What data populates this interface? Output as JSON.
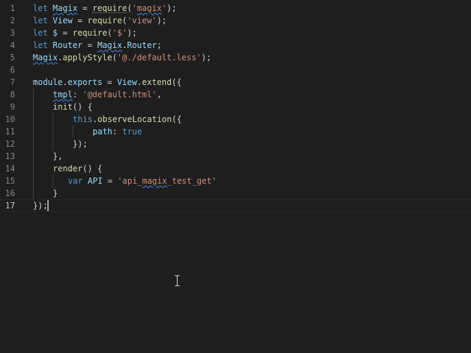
{
  "editor": {
    "line_numbers": [
      "1",
      "2",
      "3",
      "4",
      "5",
      "6",
      "7",
      "8",
      "9",
      "10",
      "11",
      "12",
      "13",
      "14",
      "15",
      "16",
      "17"
    ],
    "lines": {
      "l1": {
        "t1": "let",
        "t2": " ",
        "t3": "Magix",
        "t4": " = ",
        "t5": "require",
        "t6": "(",
        "t7": "'",
        "t8": "magix",
        "t9": "'",
        "t10": ");"
      },
      "l2": {
        "t1": "let",
        "t2": " ",
        "t3": "View",
        "t4": " = ",
        "t5": "require",
        "t6": "(",
        "t7": "'view'",
        "t8": ");"
      },
      "l3": {
        "t1": "let",
        "t2": " ",
        "t3": "$",
        "t4": " = ",
        "t5": "require",
        "t6": "(",
        "t7": "'$'",
        "t8": ");"
      },
      "l4": {
        "t1": "let",
        "t2": " ",
        "t3": "Router",
        "t4": " = ",
        "t5": "Magix",
        "t6": ".",
        "t7": "Router",
        "t8": ";"
      },
      "l5": {
        "t1": "Magix",
        "t2": ".",
        "t3": "applyStyle",
        "t4": "(",
        "t5": "'@./default.less'",
        "t6": ");"
      },
      "l7": {
        "t1": "module",
        "t2": ".",
        "t3": "exports",
        "t4": " = ",
        "t5": "View",
        "t6": ".",
        "t7": "extend",
        "t8": "({"
      },
      "l8": {
        "t1": "tmpl",
        "t2": ": ",
        "t3": "'@default.html'",
        "t4": ","
      },
      "l9": {
        "t1": "init",
        "t2": "() {"
      },
      "l10": {
        "t1": "this",
        "t2": ".",
        "t3": "observeLocation",
        "t4": "({"
      },
      "l11": {
        "t1": "path",
        "t2": ": ",
        "t3": "true"
      },
      "l12": {
        "t1": "});"
      },
      "l13": {
        "t1": "},"
      },
      "l14": {
        "t1": "render",
        "t2": "() {"
      },
      "l15": {
        "t1": "var",
        "t2": " ",
        "t3": "API",
        "t4": " = ",
        "t5": "'api_",
        "t6": "magix",
        "t7": "_test_get'"
      },
      "l16": {
        "t1": "}"
      },
      "l17": {
        "t1": "});"
      }
    }
  },
  "colors": {
    "background": "#1e1e1e",
    "keyword": "#569cd6",
    "string": "#ce9178",
    "variable": "#9cdcfe",
    "function": "#dcdcaa",
    "line_number": "#858585"
  }
}
